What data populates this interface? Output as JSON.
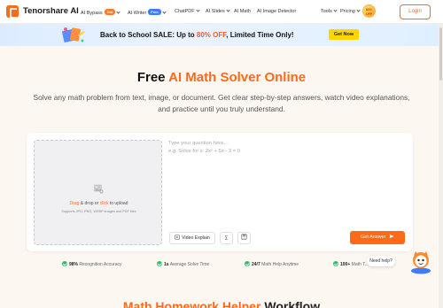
{
  "brand": {
    "name": "Tenorshare AI"
  },
  "nav": {
    "items": [
      {
        "label": "AI Bypass",
        "badge": "Hot"
      },
      {
        "label": "AI Writer",
        "badge": "Free"
      },
      {
        "label": "ChatPDF"
      },
      {
        "label": "AI Slides"
      },
      {
        "label": "AI Math"
      },
      {
        "label": "AI Image Detector"
      }
    ],
    "tools": "Tools",
    "pricing": "Pricing",
    "promo_badge": "80% OFF",
    "login": "Login"
  },
  "banner": {
    "text_prefix": "Back to School SALE: Up to ",
    "highlight": "80% OFF",
    "text_suffix": ", Limited Time Only!",
    "cta": "Get Now"
  },
  "hero": {
    "title_plain": "Free ",
    "title_accent": "AI Math Solver Online",
    "subtitle": "Solve any math problem from text, image, or document. Get clear step-by-step answers, watch video explanations, and practice until you truly understand."
  },
  "upload": {
    "drag": "Drag",
    "middle": " & drop or ",
    "click": "click",
    "end": " to upload",
    "hint": "Supports JPG, PNG, WEBP images and PDF files"
  },
  "question": {
    "placeholder": "Type your question here...\ne.g. Solve for x: 2x² + 5x - 3 = 0"
  },
  "toolbar": {
    "video_explain": "Video Explain",
    "sigma": "∑",
    "get_answer": "Get Answer"
  },
  "stats": [
    {
      "value": "98%",
      "label": "Recognition Accuracy"
    },
    {
      "value": "1s",
      "label": "Average Solve Time"
    },
    {
      "value": "24/7",
      "label": "Math Help Anytime"
    },
    {
      "value": "100+",
      "label": "Math T..."
    }
  ],
  "help": {
    "label": "Need help?"
  },
  "section": {
    "accent": "Math Homework Helper",
    "plain": " Workflow"
  },
  "colors": {
    "accent": "#ff6a1a",
    "banner_cta": "#ffd500",
    "check": "#2ebd6b"
  }
}
